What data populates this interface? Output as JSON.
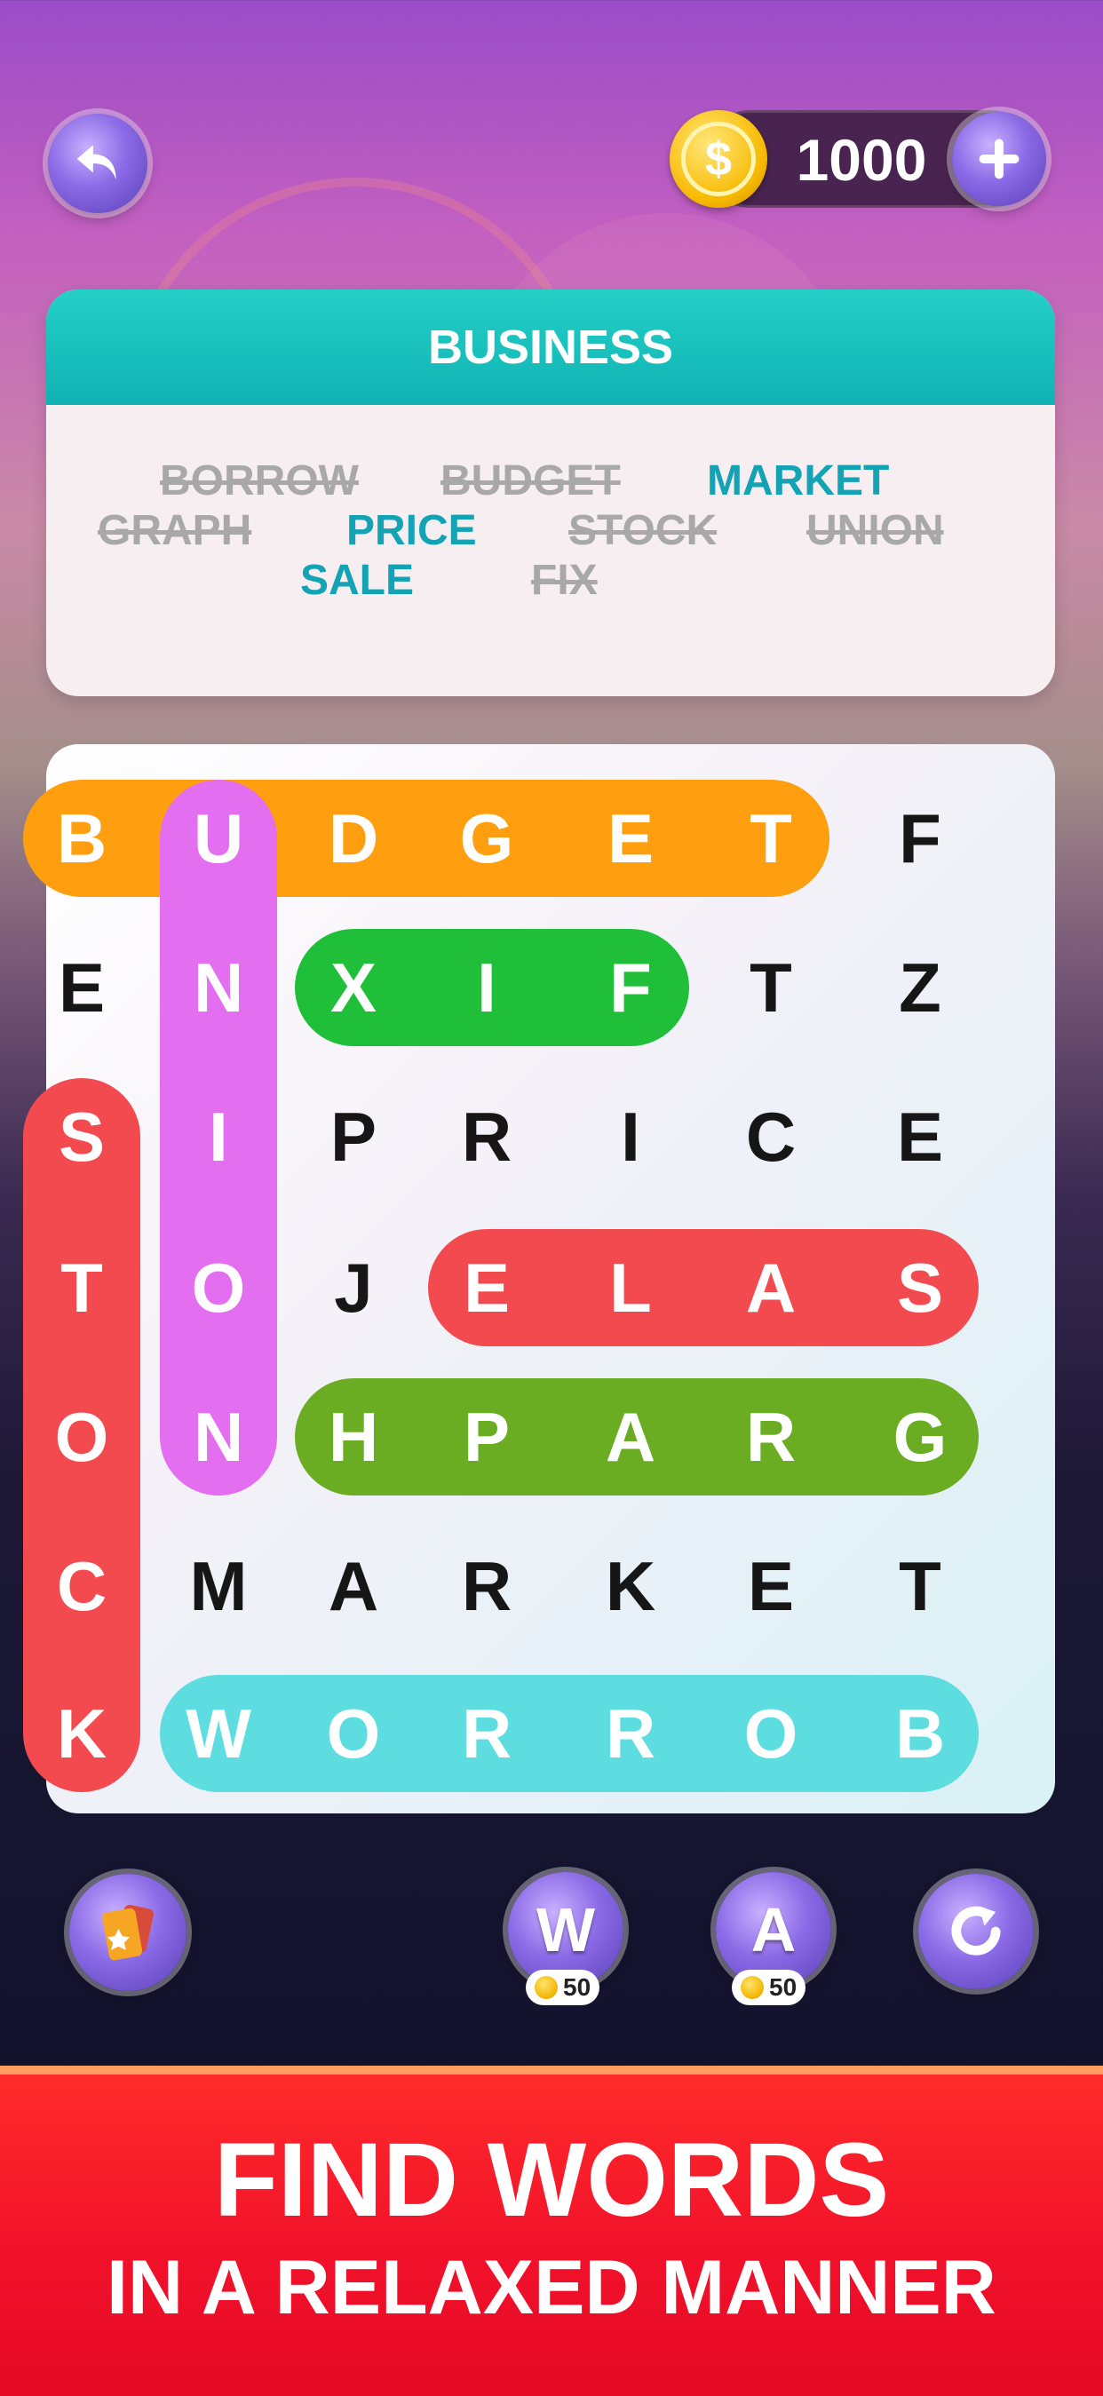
{
  "coins": {
    "amount": "1000"
  },
  "category": {
    "title": "BUSINESS"
  },
  "words": [
    {
      "text": "BORROW",
      "status": "found"
    },
    {
      "text": "BUDGET",
      "status": "found"
    },
    {
      "text": "MARKET",
      "status": "todo"
    },
    {
      "text": "GRAPH",
      "status": "found"
    },
    {
      "text": "PRICE",
      "status": "todo"
    },
    {
      "text": "STOCK",
      "status": "found"
    },
    {
      "text": "UNION",
      "status": "found"
    },
    {
      "text": "SALE",
      "status": "todo"
    },
    {
      "text": "FIX",
      "status": "found"
    }
  ],
  "grid": {
    "rows": [
      [
        "B",
        "U",
        "D",
        "G",
        "E",
        "T",
        "F"
      ],
      [
        "E",
        "N",
        "X",
        "I",
        "F",
        "T",
        "Z"
      ],
      [
        "S",
        "I",
        "P",
        "R",
        "I",
        "C",
        "E"
      ],
      [
        "T",
        "O",
        "J",
        "E",
        "L",
        "A",
        "S"
      ],
      [
        "O",
        "N",
        "H",
        "P",
        "A",
        "R",
        "G"
      ],
      [
        "C",
        "M",
        "A",
        "R",
        "K",
        "E",
        "T"
      ],
      [
        "K",
        "W",
        "O",
        "R",
        "R",
        "O",
        "B"
      ]
    ],
    "highlights": [
      {
        "word": "BUDGET",
        "color": "#ff9f0f",
        "from": [
          0,
          0
        ],
        "to": [
          0,
          5
        ]
      },
      {
        "word": "UNION",
        "color": "#e36ef0",
        "from": [
          0,
          1
        ],
        "to": [
          4,
          1
        ]
      },
      {
        "word": "FIX",
        "color": "#1fbf3a",
        "from": [
          1,
          4
        ],
        "to": [
          1,
          2
        ]
      },
      {
        "word": "STOCK",
        "color": "#f24a4f",
        "from": [
          2,
          0
        ],
        "to": [
          6,
          0
        ]
      },
      {
        "word": "SALE",
        "color": "#f24a4f",
        "from": [
          3,
          6
        ],
        "to": [
          3,
          3
        ]
      },
      {
        "word": "GRAPH",
        "color": "#6aad23",
        "from": [
          4,
          6
        ],
        "to": [
          4,
          2
        ]
      },
      {
        "word": "BORROW",
        "color": "#5edde0",
        "from": [
          6,
          6
        ],
        "to": [
          6,
          1
        ]
      }
    ]
  },
  "powerups": {
    "word_hint": {
      "letter": "W",
      "cost": "50"
    },
    "letter_hint": {
      "letter": "A",
      "cost": "50"
    }
  },
  "banner": {
    "line1": "FIND WORDS",
    "line2": "IN A RELAXED MANNER"
  },
  "icons": [
    "back-arrow-icon",
    "coin-icon",
    "plus-icon",
    "cards-icon",
    "reshuffle-icon"
  ]
}
